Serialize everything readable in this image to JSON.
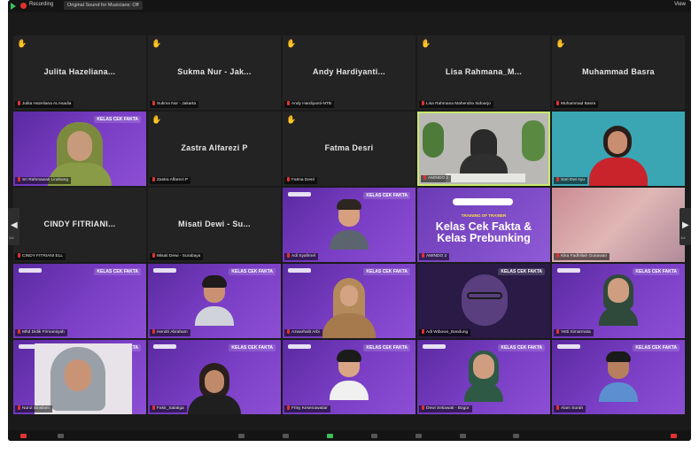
{
  "topbar": {
    "recording_label": "Recording",
    "original_sound": "Original Sound for Musicians: Off",
    "view_label": "View"
  },
  "navigation": {
    "prev_page": "1/4",
    "next_page": "1/4"
  },
  "banner": {
    "subtitle": "TRAINING OF TRAINER",
    "line1": "Kelas Cek Fakta &",
    "line2": "Kelas Prebunking"
  },
  "brand_text": "KELAS CEK FAKTA",
  "colors": {
    "zoom_bg": "#1a1a1a",
    "tile_purple": "#7b3fc6",
    "raised_hand": "#f2b21b",
    "muted_red": "#e0322f",
    "recording_red": "#e0322f"
  },
  "participants": [
    {
      "display": "Julita Hazeliana...",
      "label": "Julita Hazeliana ALAsadia",
      "raised_hand": true
    },
    {
      "display": "Sukma Nur - Jak...",
      "label": "Sukma Nur - Jakarta",
      "raised_hand": true
    },
    {
      "display": "Andy Hardiyanti...",
      "label": "Andy Hardiyanti-NTB",
      "raised_hand": true
    },
    {
      "display": "Lisa Rahmana_M...",
      "label": "Lisa Rahmana Mahendra Sidoarjo",
      "raised_hand": true
    },
    {
      "display": "Muhammad Basra",
      "label": "Muhammad Basra",
      "raised_hand": true
    },
    {
      "display": "",
      "label": "Sri Rahmawati Lindsang",
      "raised_hand": false
    },
    {
      "display": "Zastra Alfarezi P",
      "label": "Zastra Alfarezi P",
      "raised_hand": true
    },
    {
      "display": "Fatma Desri",
      "label": "Fatma Desri",
      "raised_hand": true
    },
    {
      "display": "",
      "label": "AMINDO 1",
      "raised_hand": false
    },
    {
      "display": "",
      "label": "Sari Dwi Ayu",
      "raised_hand": false
    },
    {
      "display": "CINDY FITRIANI...",
      "label": "CINDY FITRIANI ELL",
      "raised_hand": false
    },
    {
      "display": "Misati Dewi - Su...",
      "label": "Misati Dewi - Surabaya",
      "raised_hand": false
    },
    {
      "display": "",
      "label": "Adi Syafirnel",
      "raised_hand": false
    },
    {
      "display": "",
      "label": "AMINDO 2",
      "raised_hand": false
    },
    {
      "display": "",
      "label": "Kika Fadhillah Gunawan",
      "raised_hand": false
    },
    {
      "display": "",
      "label": "Mhd Didik Firmansyah",
      "raised_hand": false
    },
    {
      "display": "",
      "label": "Hendri Abraham",
      "raised_hand": false
    },
    {
      "display": "",
      "label": "Azwarhalit Arbi",
      "raised_hand": false
    },
    {
      "display": "",
      "label": "Adi Wibowo_Bandung",
      "raised_hand": false
    },
    {
      "display": "",
      "label": "Yetti Simarmata",
      "raised_hand": false
    },
    {
      "display": "",
      "label": "Nurul Sinsilani",
      "raised_hand": false
    },
    {
      "display": "",
      "label": "Fakir_Salatiga",
      "raised_hand": false
    },
    {
      "display": "",
      "label": "Frisy Kesenawatiar",
      "raised_hand": false
    },
    {
      "display": "",
      "label": "Dewi Setiawati - Bogor",
      "raised_hand": false
    },
    {
      "display": "",
      "label": "Alam Surah",
      "raised_hand": false
    }
  ]
}
